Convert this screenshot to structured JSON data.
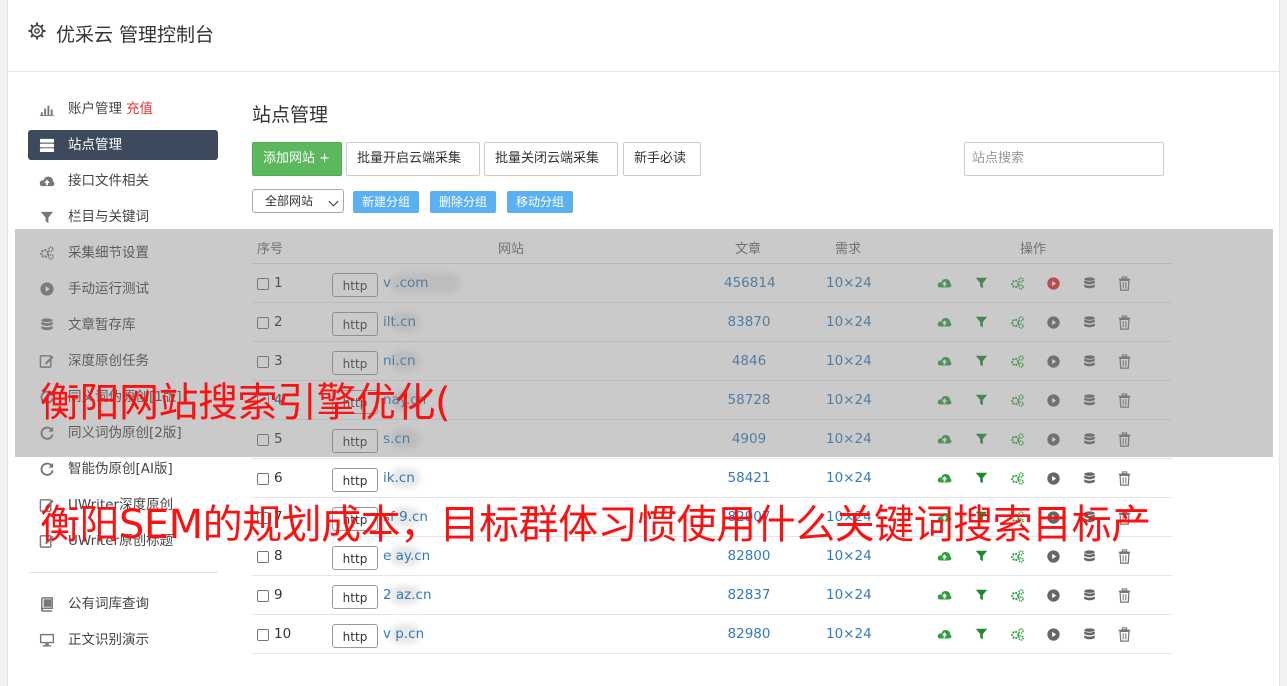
{
  "header": {
    "title": "优采云 管理控制台"
  },
  "sidebar": {
    "items": [
      {
        "label": "账户管理",
        "extra": "充值",
        "icon": "bar-chart-icon"
      },
      {
        "label": "站点管理",
        "icon": "server-icon",
        "active": true
      },
      {
        "label": "接口文件相关",
        "icon": "cloud-upload-icon"
      },
      {
        "label": "栏目与关键词",
        "icon": "filter-icon"
      },
      {
        "label": "采集细节设置",
        "icon": "gears-icon"
      },
      {
        "label": "手动运行测试",
        "icon": "play-icon"
      },
      {
        "label": "文章暂存库",
        "icon": "database-icon"
      },
      {
        "label": "深度原创任务",
        "icon": "edit-icon"
      },
      {
        "label": "同义词伪原创[1版]",
        "icon": "refresh-icon"
      },
      {
        "label": "同义词伪原创[2版]",
        "icon": "refresh-icon"
      },
      {
        "label": "智能伪原创[AI版]",
        "icon": "refresh-icon"
      },
      {
        "label": "UWriter深度原创",
        "icon": "edit-icon"
      },
      {
        "label": "UWriter原创标题",
        "icon": "edit-icon"
      }
    ],
    "bottom_items": [
      {
        "label": "公有词库查询",
        "icon": "book-icon"
      },
      {
        "label": "正文识别演示",
        "icon": "monitor-icon"
      }
    ]
  },
  "main": {
    "title": "站点管理",
    "toolbar": {
      "add_site": "添加网站 +",
      "batch_on": "批量开启云端采集",
      "batch_off": "批量关闭云端采集",
      "guide": "新手必读"
    },
    "search_placeholder": "站点搜索",
    "group_select": "全部网站",
    "group_buttons": {
      "new": "新建分组",
      "delete": "删除分组",
      "move": "移动分组"
    },
    "table": {
      "headers": {
        "index": "序号",
        "site": "网站",
        "articles": "文章",
        "demand": "需求",
        "actions": "操作"
      },
      "rows": [
        {
          "index": "1",
          "site": "v           .com",
          "articles": "456814",
          "demand": "10×24"
        },
        {
          "index": "2",
          "site": "     ilt.cn",
          "articles": "83870",
          "demand": "10×24"
        },
        {
          "index": "3",
          "site": "     ni.cn",
          "articles": "4846",
          "demand": "10×24"
        },
        {
          "index": "4",
          "site": "     nay.cn",
          "articles": "58728",
          "demand": "10×24"
        },
        {
          "index": "5",
          "site": "     s.cn",
          "articles": "4909",
          "demand": "10×24"
        },
        {
          "index": "6",
          "site": "     ik.cn",
          "articles": "58421",
          "demand": "10×24"
        },
        {
          "index": "7",
          "site": "    sf  9.cn",
          "articles": "82907",
          "demand": "10×24"
        },
        {
          "index": "8",
          "site": "e     ay.cn",
          "articles": "82800",
          "demand": "10×24"
        },
        {
          "index": "9",
          "site": "2     az.cn",
          "articles": "82837",
          "demand": "10×24"
        },
        {
          "index": "10",
          "site": "v     p.cn",
          "articles": "82980",
          "demand": "10×24"
        }
      ],
      "http_label": "http"
    }
  },
  "overlay": {
    "line1": "衡阳网站搜索引擎优化(",
    "line2": "衡阳SEM的规划成本，目标群体习惯使用什么关键词搜索目标产"
  },
  "colors": {
    "sidebar_active": "#3d4a5d",
    "recharge": "#e8352f",
    "primary_green": "#5cb85c",
    "small_button_blue": "#5bb0f0",
    "link_blue": "#337ab7",
    "overlay_red": "#ff1010"
  }
}
